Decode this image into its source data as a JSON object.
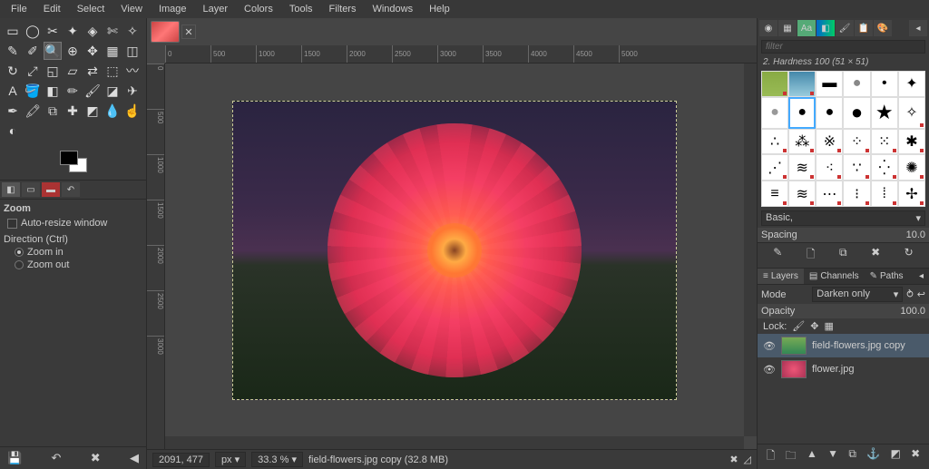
{
  "menubar": [
    "File",
    "Edit",
    "Select",
    "View",
    "Image",
    "Layer",
    "Colors",
    "Tools",
    "Filters",
    "Windows",
    "Help"
  ],
  "tool_options": {
    "title": "Zoom",
    "auto_resize": "Auto-resize window",
    "direction_label": "Direction  (Ctrl)",
    "zoom_in": "Zoom in",
    "zoom_out": "Zoom out"
  },
  "statusbar": {
    "coords": "2091, 477",
    "unit": "px",
    "zoom": "33.3 %",
    "file_info": "field-flowers.jpg copy (32.8 MB)"
  },
  "brushes": {
    "filter_placeholder": "filter",
    "title": "2. Hardness 100 (51 × 51)",
    "preset": "Basic,",
    "spacing_label": "Spacing",
    "spacing_value": "10.0"
  },
  "layers": {
    "tabs": [
      "Layers",
      "Channels",
      "Paths"
    ],
    "mode_label": "Mode",
    "mode_value": "Darken only",
    "opacity_label": "Opacity",
    "opacity_value": "100.0",
    "lock_label": "Lock:",
    "items": [
      {
        "name": "field-flowers.jpg copy"
      },
      {
        "name": "flower.jpg"
      }
    ]
  },
  "ruler_h": [
    "0",
    "500",
    "1000",
    "1500",
    "2000",
    "2500",
    "3000",
    "3500",
    "4000",
    "4500",
    "5000"
  ],
  "ruler_v": [
    "0",
    "500",
    "1000",
    "1500",
    "2000",
    "2500",
    "3000"
  ]
}
